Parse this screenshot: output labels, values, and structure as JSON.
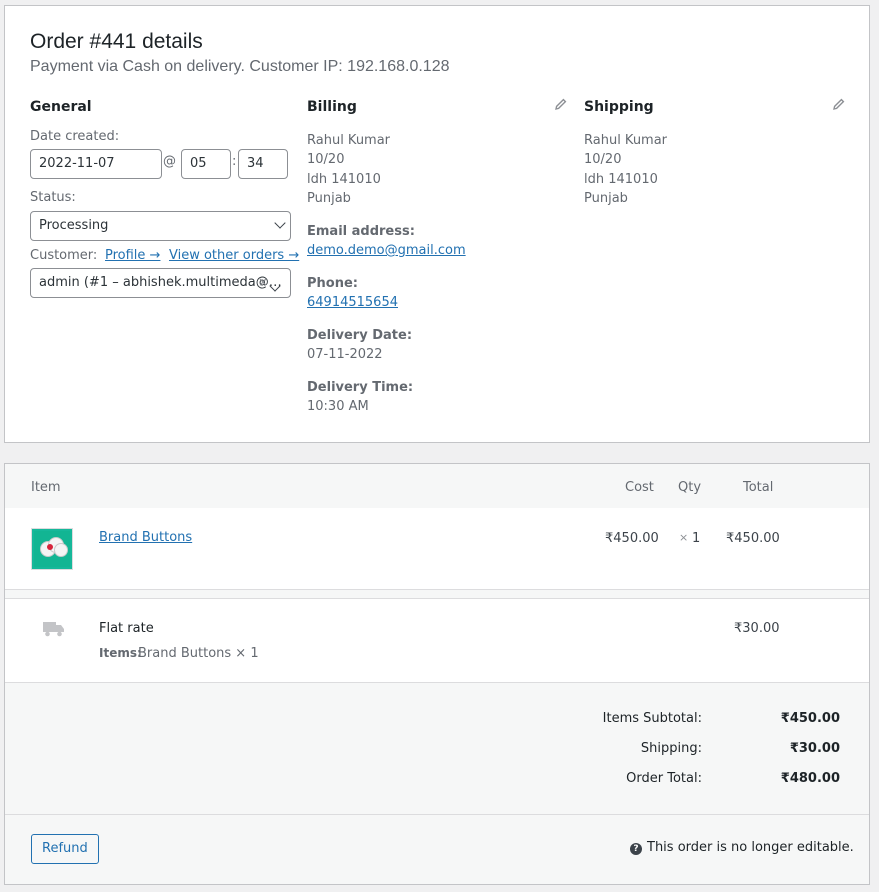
{
  "header": {
    "title": "Order #441 details",
    "subtitle": "Payment via Cash on delivery. Customer IP: 192.168.0.128"
  },
  "general": {
    "heading": "General",
    "date_label": "Date created:",
    "date_value": "2022-11-07",
    "at": "@",
    "hour": "05",
    "colon": ":",
    "minute": "34",
    "status_label": "Status:",
    "status_value": "Processing",
    "customer_label": "Customer:",
    "profile_link": "Profile →",
    "other_orders_link": "View other orders →",
    "customer_value": "admin (#1 – abhishek.multimeda@…",
    "clear": "×"
  },
  "billing": {
    "heading": "Billing",
    "address": [
      "Rahul Kumar",
      "10/20",
      "ldh 141010",
      "Punjab"
    ],
    "email_label": "Email address:",
    "email": "demo.demo@gmail.com",
    "phone_label": "Phone:",
    "phone": "64914515654",
    "delivery_date_label": "Delivery Date:",
    "delivery_date": "07-11-2022",
    "delivery_time_label": "Delivery Time:",
    "delivery_time": "10:30 AM"
  },
  "shipping": {
    "heading": "Shipping",
    "address": [
      "Rahul Kumar",
      "10/20",
      "ldh 141010",
      "Punjab"
    ]
  },
  "items_table": {
    "headers": {
      "item": "Item",
      "cost": "Cost",
      "qty": "Qty",
      "total": "Total"
    },
    "line_item": {
      "name": "Brand Buttons",
      "cost": "₹450.00",
      "qty_x": "×",
      "qty": "1",
      "total": "₹450.00"
    },
    "shipping_line": {
      "name": "Flat rate",
      "items_label": "Items:",
      "items_value": "Brand Buttons × 1",
      "total": "₹30.00"
    }
  },
  "totals": {
    "subtotal_label": "Items Subtotal:",
    "subtotal": "₹450.00",
    "shipping_label": "Shipping:",
    "shipping": "₹30.00",
    "order_total_label": "Order Total:",
    "order_total": "₹480.00"
  },
  "footer": {
    "refund_label": "Refund",
    "note": "This order is no longer editable.",
    "help_glyph": "?"
  },
  "icons": {
    "edit": "pencil-icon",
    "truck": "truck-icon",
    "help": "help-icon"
  },
  "colors": {
    "link": "#2271b1",
    "thumb_bg": "#16b89a"
  }
}
